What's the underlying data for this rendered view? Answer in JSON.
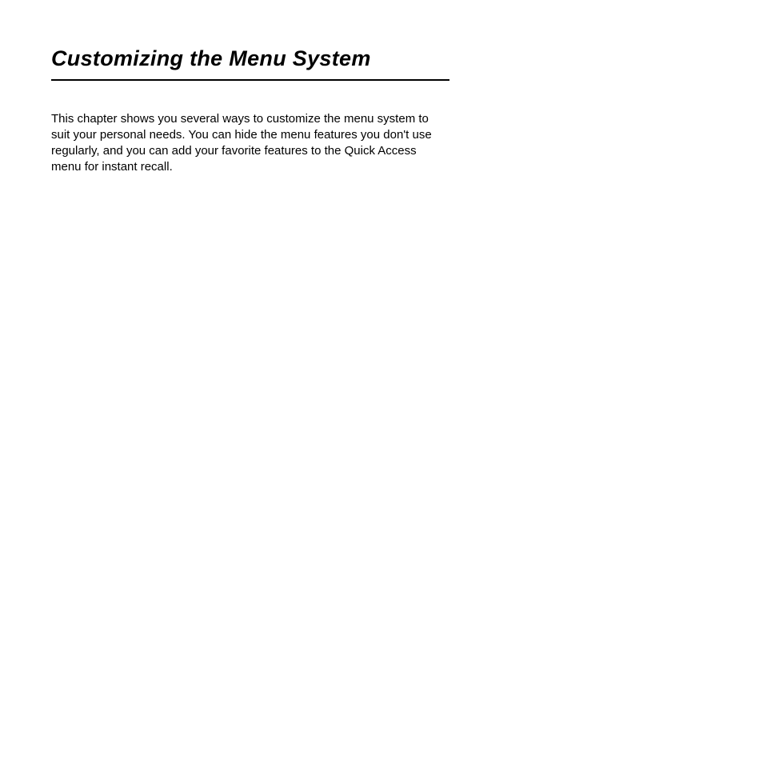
{
  "chapter": {
    "title": "Customizing the Menu System",
    "intro": "This chapter shows you several ways to customize the menu system to suit your personal needs. You can hide the menu features you don't use regularly, and you can add your favorite features to the Quick Access menu for instant recall."
  }
}
